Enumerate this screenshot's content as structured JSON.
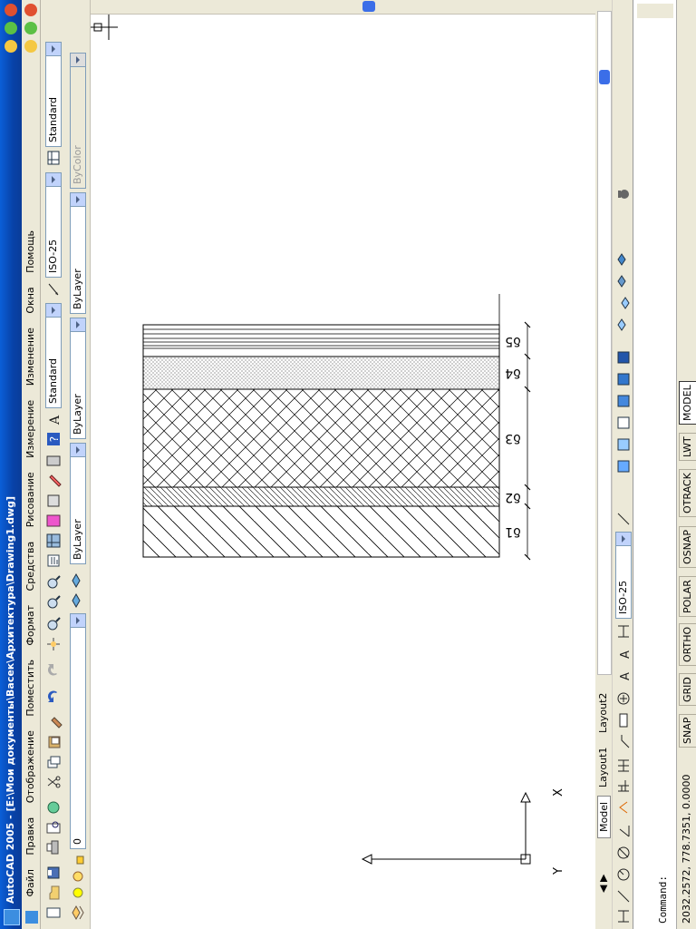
{
  "app": {
    "title": "AutoCAD 2005 - [E:\\Мои документы\\Васек\\Архитектура\\Drawing1.dwg]"
  },
  "menu": [
    "Файл",
    "Правка",
    "Отображение",
    "Поместить",
    "Формат",
    "Средства",
    "Рисование",
    "Измерение",
    "Изменение",
    "Окна",
    "Помощь"
  ],
  "styles": {
    "text_style": "Standard",
    "dim_style_top": "ISO-25",
    "table_style": "Standard",
    "dim_style_right": "ISO-25"
  },
  "properties": {
    "layer": "0",
    "color": "ByLayer",
    "linetype": "ByLayer",
    "lineweight": "ByLayer",
    "plot_style": "ByColor"
  },
  "drawing": {
    "labels": [
      "δ1",
      "δ2",
      "δ3",
      "δ4",
      "δ5"
    ],
    "ucs": {
      "x": "X",
      "y": "Y"
    }
  },
  "tabs": [
    "Model",
    "Layout1",
    "Layout2"
  ],
  "command": {
    "prompt": "Command:",
    "coords": "2032.2572, 778.7351, 0.0000"
  },
  "status": [
    "SNAP",
    "GRID",
    "ORTHO",
    "POLAR",
    "OSNAP",
    "OTRACK",
    "LWT",
    "MODEL"
  ],
  "colors": {
    "accent": "#0842a8",
    "drawing_bg": "#ffffff",
    "toolbar": "#ece9d8"
  }
}
